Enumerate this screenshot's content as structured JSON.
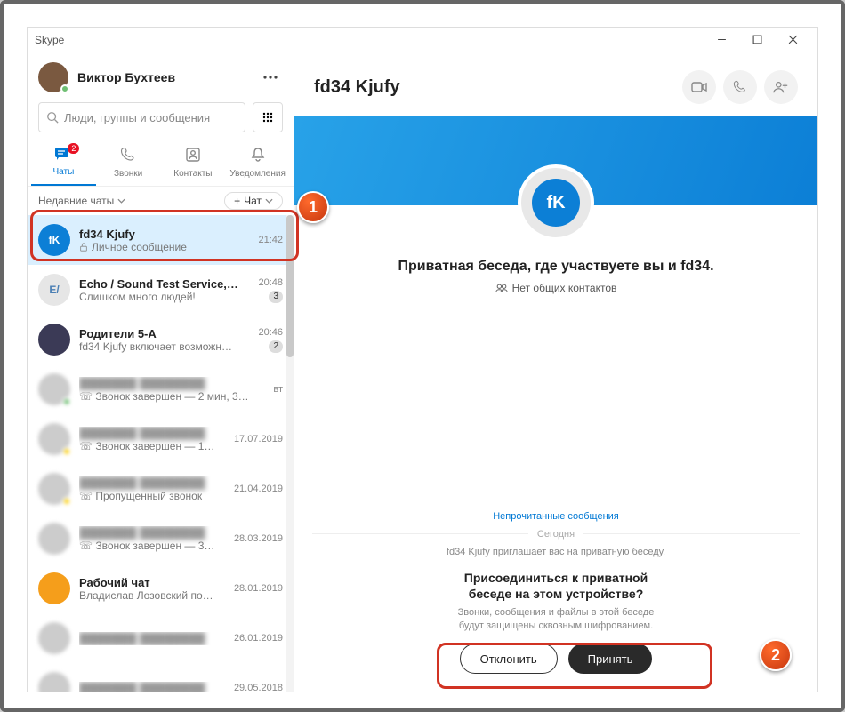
{
  "window": {
    "title": "Skype"
  },
  "user": {
    "name": "Виктор Бухтеев"
  },
  "search": {
    "placeholder": "Люди, группы и сообщения"
  },
  "nav": {
    "chats": {
      "label": "Чаты",
      "badge": "2"
    },
    "calls": {
      "label": "Звонки"
    },
    "contacts": {
      "label": "Контакты"
    },
    "notifications": {
      "label": "Уведомления"
    }
  },
  "sublist": {
    "recent": "Недавние чаты",
    "new_chat_label": "Чат"
  },
  "chats": [
    {
      "name": "fd34 Kjufy",
      "sub": "Личное сообщение",
      "time": "21:42",
      "selected": true,
      "avatar_text": "fK",
      "avatar_bg": "#0c7fd6",
      "locked": true
    },
    {
      "name": "Echo / Sound Test Service,…",
      "sub": "Слишком много людей!",
      "time": "20:48",
      "avatar_text": "E/",
      "avatar_bg": "#e6e6e6",
      "avatar_fg": "#4a7fb4",
      "badge": "3"
    },
    {
      "name": "Родители 5-А",
      "sub": "fd34 Kjufy включает возможн…",
      "time": "20:46",
      "avatar_bg": "#3b3a56",
      "badge": "2"
    },
    {
      "name_blurred": true,
      "sub": "☏ Звонок завершен — 2 мин, 3…",
      "time": "вт",
      "avatar_blurred": true,
      "dot": "g"
    },
    {
      "name_blurred": true,
      "sub": "☏ Звонок завершен — 1…",
      "time": "17.07.2019",
      "avatar_blurred": true,
      "dot": "y"
    },
    {
      "name_blurred": true,
      "sub": "☏ Пропущенный звонок",
      "time": "21.04.2019",
      "avatar_blurred": true,
      "dot": "y"
    },
    {
      "name_blurred": true,
      "sub": "☏ Звонок завершен — 3…",
      "time": "28.03.2019",
      "avatar_blurred": true
    },
    {
      "name": "Рабочий чат",
      "sub": "Владислав Лозовский по…",
      "time": "28.01.2019",
      "avatar_bg": "#f59e1b"
    },
    {
      "name_blurred": true,
      "sub": "",
      "time": "26.01.2019",
      "avatar_blurred": true
    },
    {
      "name_blurred": true,
      "sub": "",
      "time": "29.05.2018",
      "avatar_blurred": true
    }
  ],
  "conversation": {
    "title": "fd34 Kjufy",
    "avatar_text": "fK",
    "headline": "Приватная беседа, где участвуете вы и fd34.",
    "no_common": "Нет общих контактов",
    "unread_label": "Непрочитанные сообщения",
    "today_label": "Сегодня",
    "invite_line": "fd34 Kjufy приглашает вас на приватную беседу.",
    "join_question_l1": "Присоединиться к приватной",
    "join_question_l2": "беседе на этом устройстве?",
    "join_desc_l1": "Звонки, сообщения и файлы в этой беседе",
    "join_desc_l2": "будут защищены сквозным шифрованием.",
    "decline": "Отклонить",
    "accept": "Принять"
  },
  "callouts": {
    "one": "1",
    "two": "2"
  }
}
